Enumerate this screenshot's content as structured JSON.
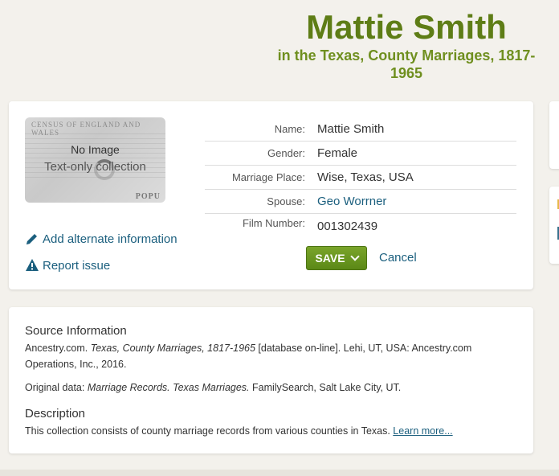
{
  "header": {
    "title": "Mattie Smith",
    "subtitle": "in the Texas, County Marriages, 1817-1965"
  },
  "thumbnail": {
    "census_text": "CENSUS OF ENGLAND AND WALES",
    "popu_text": "POPU",
    "no_image": "No Image",
    "text_only": "Text-only collection"
  },
  "actions": {
    "add_alternate": "Add alternate information",
    "report_issue": "Report issue"
  },
  "fields": [
    {
      "label": "Name:",
      "value": "Mattie Smith"
    },
    {
      "label": "Gender:",
      "value": "Female"
    },
    {
      "label": "Marriage Place:",
      "value": "Wise, Texas, USA"
    },
    {
      "label": "Spouse:",
      "value": "Geo Worrner"
    },
    {
      "label": "Film Number:",
      "value": "001302439"
    }
  ],
  "buttons": {
    "save": "SAVE",
    "cancel": "Cancel"
  },
  "source": {
    "heading": "Source Information",
    "citation_prefix": "Ancestry.com. ",
    "citation_title": "Texas, County Marriages, 1817-1965",
    "citation_suffix": " [database on-line]. Lehi, UT, USA: Ancestry.com Operations, Inc., 2016.",
    "original_prefix": "Original data: ",
    "original_title": "Marriage Records. Texas Marriages.",
    "original_suffix": " FamilySearch, Salt Lake City, UT."
  },
  "description": {
    "heading": "Description",
    "text": "This collection consists of county marriage records from various counties in Texas. ",
    "link": "Learn more..."
  },
  "colors": {
    "title_green": "#5e7d16",
    "link_blue": "#1b5f7e",
    "save_green": "#6b9a20"
  }
}
